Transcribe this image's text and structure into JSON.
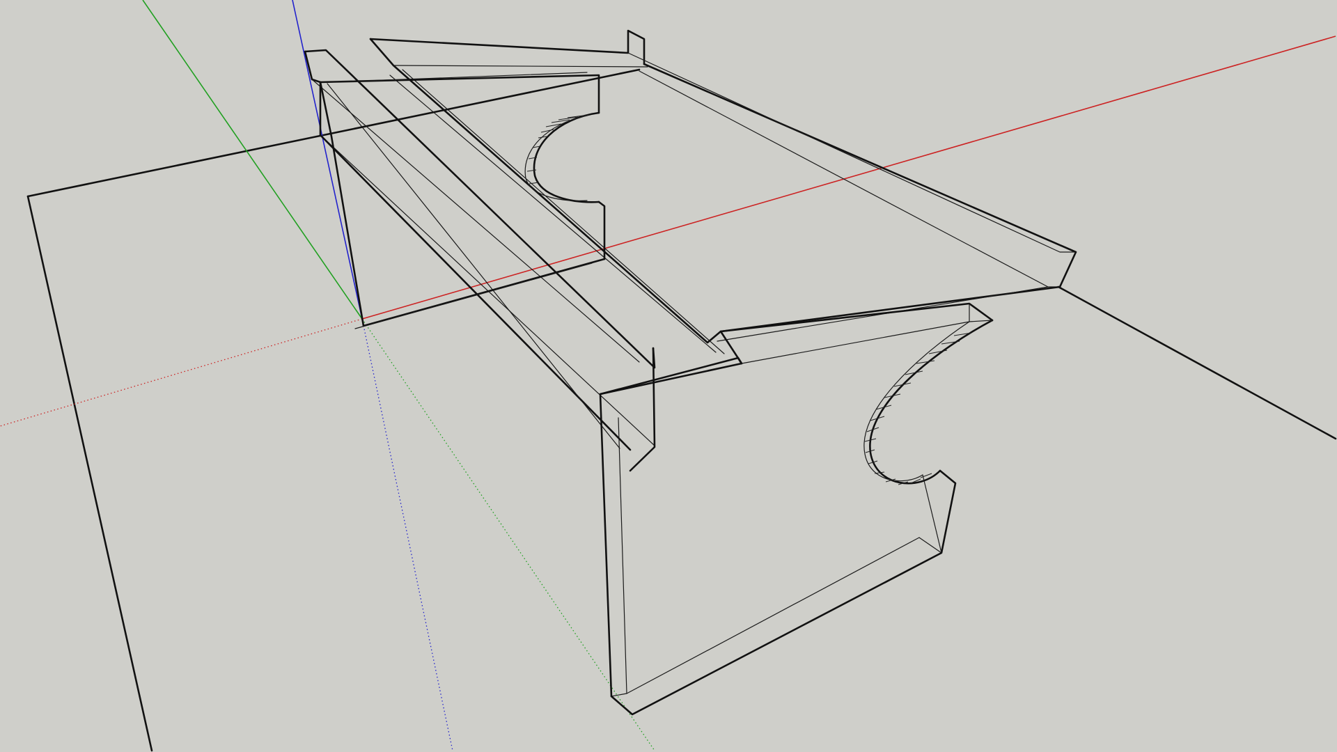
{
  "viewport": {
    "background": "#cfcfca",
    "camera": "perspective",
    "edge_color": "#111111"
  },
  "axes": {
    "red": {
      "color": "#cc2222",
      "name": "red-axis"
    },
    "green": {
      "color": "#21a021",
      "name": "green-axis"
    },
    "blue": {
      "color": "#2222cc",
      "name": "blue-axis"
    }
  },
  "model": {
    "name": "wooden-bracket-shelf",
    "render_style": "x-ray"
  }
}
